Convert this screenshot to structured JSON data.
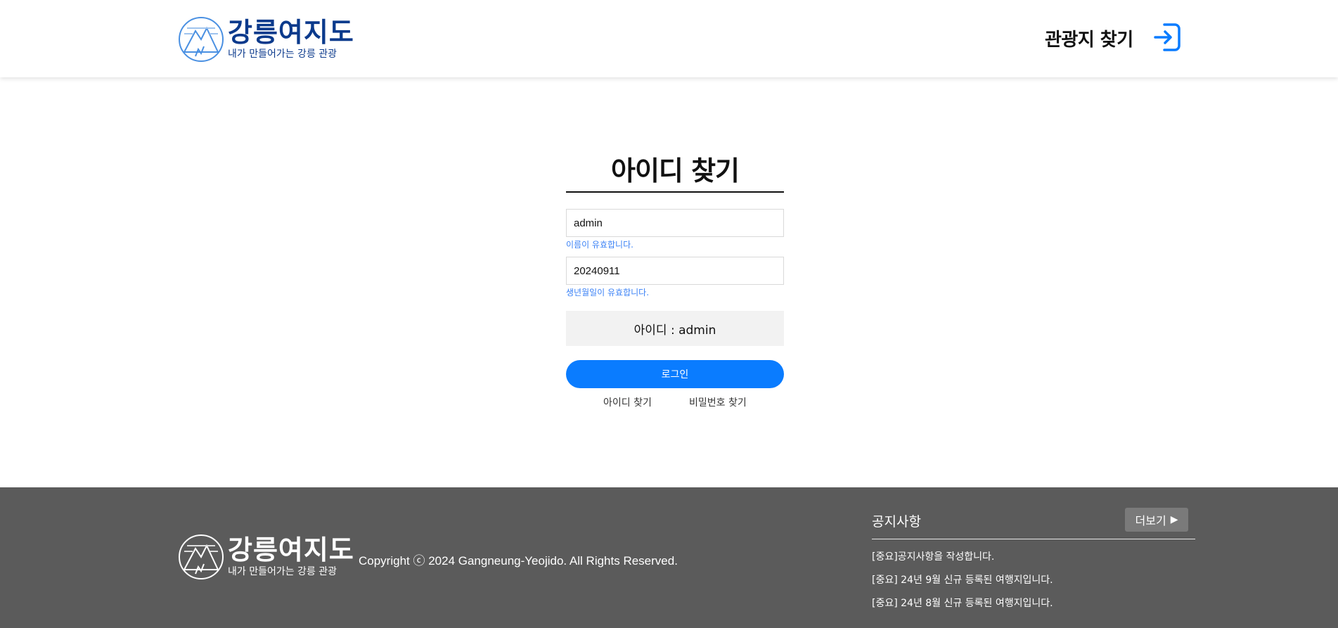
{
  "header": {
    "logo_title": "강릉여지도",
    "logo_subtitle": "내가 만들어가는 강릉 관광",
    "nav_find": "관광지 찾기"
  },
  "main": {
    "title": "아이디 찾기",
    "name_value": "admin",
    "name_valid": "이름이 유효합니다.",
    "birth_value": "20240911",
    "birth_valid": "생년월일이 유효합니다.",
    "result": "아이디 : admin",
    "login_button": "로그인",
    "find_id_link": "아이디 찾기",
    "find_pw_link": "비밀번호 찾기"
  },
  "footer": {
    "logo_title": "강릉여지도",
    "logo_subtitle": "내가 만들어가는 강릉 관광",
    "copyright": "Copyright ⓒ 2024 Gangneung-Yeojido. All Rights Reserved.",
    "notice_title": "공지사항",
    "more_label": "더보기",
    "notices": [
      "[중요]공지사항을 작성합니다.",
      "[중요] 24년 9월 신규 등록된 여행지입니다.",
      "[중요] 24년 8월 신규 등록된 여행지입니다."
    ]
  },
  "colors": {
    "brand_navy": "#0b3a8c",
    "accent_blue": "#0a7cff",
    "valid_text": "#3b82f6",
    "footer_bg": "#5b5b5b"
  }
}
